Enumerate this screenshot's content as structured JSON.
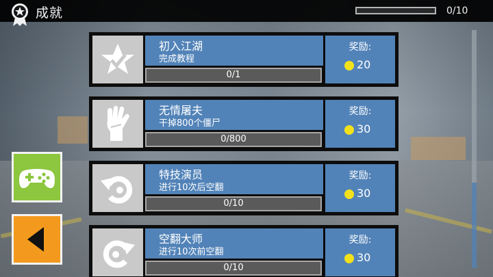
{
  "header": {
    "title": "成就",
    "progress_text": "0/10",
    "progress_fraction": 0.0
  },
  "side": {
    "game_icon": "gamepad-icon",
    "back_icon": "back-triangle-icon"
  },
  "achievements": [
    {
      "name": "初入江湖",
      "desc": "完成教程",
      "progress": "0/1",
      "fraction": 0,
      "reward_label": "奖励:",
      "reward": "20",
      "icon": "star-check-icon"
    },
    {
      "name": "无情屠夫",
      "desc": "干掉800个僵尸",
      "progress": "0/800",
      "fraction": 0,
      "reward_label": "奖励:",
      "reward": "30",
      "icon": "zombie-hand-icon"
    },
    {
      "name": "特技演员",
      "desc": "进行10次后空翻",
      "progress": "0/10",
      "fraction": 0,
      "reward_label": "奖励:",
      "reward": "30",
      "icon": "backflip-arrow-icon"
    },
    {
      "name": "空翻大师",
      "desc": "进行10次前空翻",
      "progress": "0/10",
      "fraction": 0,
      "reward_label": "奖励:",
      "reward": "30",
      "icon": "frontflip-arrow-icon"
    }
  ],
  "colors": {
    "panel_blue": "#5283b8",
    "coin": "#f3e21b",
    "game_btn": "#8dc63f",
    "back_btn": "#f39a1e"
  },
  "scroll_fraction": 0.0
}
